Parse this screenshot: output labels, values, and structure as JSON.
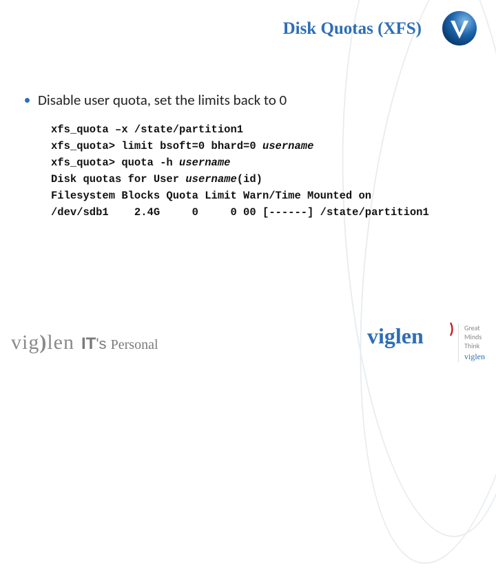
{
  "slide": {
    "title": "Disk Quotas (XFS)",
    "bullet": "Disable user quota, set the limits back to 0",
    "code": {
      "l1": "xfs_quota –x /state/partition1",
      "l2a": "xfs_quota> limit bsoft=0 bhard=0 ",
      "l2b": "username",
      "l3a": "xfs_quota> quota -h ",
      "l3b": "username",
      "l4a": "Disk quotas for User ",
      "l4b": "username",
      "l4c": "(id)",
      "l5": "Filesystem Blocks Quota Limit Warn/Time Mounted on",
      "l6": "/dev/sdb1    2.4G     0     0 00 [------] /state/partition1"
    }
  },
  "brand": {
    "viglen": "vig",
    "viglen2": "len",
    "it_big": "IT",
    "it_apos": "'s ",
    "it_word": "Personal",
    "big_logo": "viglen",
    "tag1": "Great",
    "tag2": "Minds",
    "tag3": "Think",
    "tag4": "viglen"
  }
}
